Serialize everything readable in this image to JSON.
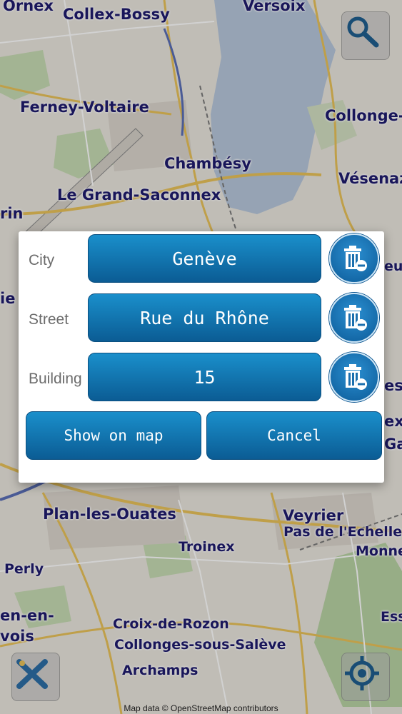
{
  "map": {
    "places": [
      {
        "id": "ornex",
        "label": "Ornex"
      },
      {
        "id": "collex-bossy",
        "label": "Collex-Bossy"
      },
      {
        "id": "versoix",
        "label": "Versoix"
      },
      {
        "id": "ferney-voltaire",
        "label": "Ferney-Voltaire"
      },
      {
        "id": "collonge-b",
        "label": "Collonge-B"
      },
      {
        "id": "chambesy",
        "label": "Chambésy"
      },
      {
        "id": "vesenaz",
        "label": "Vésenaz"
      },
      {
        "id": "le-grand-saconnex",
        "label": "Le Grand-Saconnex"
      },
      {
        "id": "rin",
        "label": "rin"
      },
      {
        "id": "euv",
        "label": "euv"
      },
      {
        "id": "ie",
        "label": "ie"
      },
      {
        "id": "es",
        "label": "es"
      },
      {
        "id": "ex",
        "label": "ex"
      },
      {
        "id": "ga",
        "label": "Ga"
      },
      {
        "id": "plan-les-ouates",
        "label": "Plan-les-Ouates"
      },
      {
        "id": "veyrier",
        "label": "Veyrier"
      },
      {
        "id": "pas-de-lechelle",
        "label": "Pas de l'Echelle"
      },
      {
        "id": "monne",
        "label": "Monne"
      },
      {
        "id": "troinex",
        "label": "Troinex"
      },
      {
        "id": "perly",
        "label": "Perly"
      },
      {
        "id": "en-en",
        "label": "en-en-"
      },
      {
        "id": "vois",
        "label": "vois"
      },
      {
        "id": "ess",
        "label": "Ess"
      },
      {
        "id": "croix-de-rozon",
        "label": "Croix-de-Rozon"
      },
      {
        "id": "collonges-sous-saleve",
        "label": "Collonges-sous-Salève"
      },
      {
        "id": "archamps",
        "label": "Archamps"
      }
    ],
    "attribution": "Map data © OpenStreetMap contributors",
    "controls": {
      "search_icon": "magnifier-icon",
      "close_icon": "cross-icon",
      "locate_icon": "target-icon"
    }
  },
  "dialog": {
    "rows": [
      {
        "label": "City",
        "value": "Genève"
      },
      {
        "label": "Street",
        "value": "Rue du Rhône"
      },
      {
        "label": "Building",
        "value": "15"
      }
    ],
    "clear_icon": "trash-minus-icon",
    "show_on_map_label": "Show on map",
    "cancel_label": "Cancel"
  },
  "colors": {
    "button_top": "#1a8fcb",
    "button_bottom": "#0b5c94",
    "water": "#b7c7dc",
    "label_text": "#1f1b6e"
  }
}
